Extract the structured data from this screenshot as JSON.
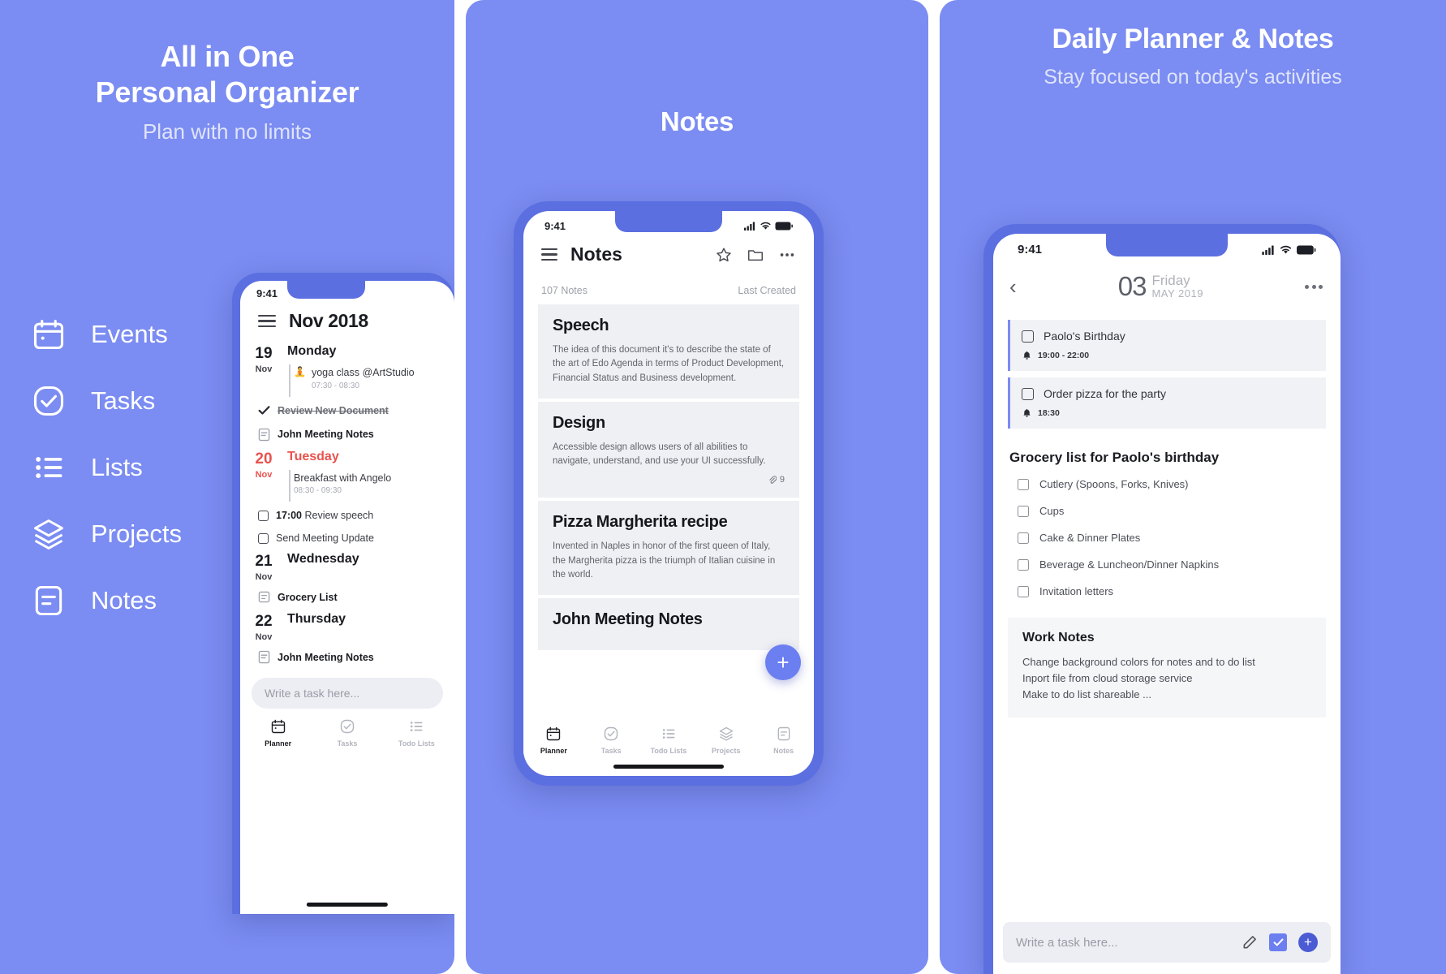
{
  "theme": {
    "brand": "#7b8cf2",
    "phone_frame": "#5b6fe0",
    "accent_red": "#e8534f",
    "fab": "#6c7ff0"
  },
  "panel1": {
    "headline_line1": "All in One",
    "headline_line2": "Personal Organizer",
    "subhead": "Plan with no limits",
    "features": [
      {
        "label": "Events",
        "icon": "calendar-icon"
      },
      {
        "label": "Tasks",
        "icon": "check-circle-icon"
      },
      {
        "label": "Lists",
        "icon": "list-icon"
      },
      {
        "label": "Projects",
        "icon": "layers-icon"
      },
      {
        "label": "Notes",
        "icon": "note-icon"
      }
    ],
    "phone": {
      "status_time": "9:41",
      "month_title": "Nov 2018",
      "days": [
        {
          "num": "19",
          "mon": "Nov",
          "weekday": "Monday",
          "today": false,
          "events": [
            {
              "emoji": "🧘",
              "title": "yoga class @ArtStudio",
              "time": "07:30 - 08:30"
            }
          ],
          "tasks": [
            {
              "type": "done",
              "text": "Review New Document"
            },
            {
              "type": "doc",
              "text": "John Meeting Notes"
            }
          ]
        },
        {
          "num": "20",
          "mon": "Nov",
          "weekday": "Tuesday",
          "today": true,
          "events": [
            {
              "emoji": "",
              "title": "Breakfast with Angelo",
              "time": "08:30 - 09:30"
            }
          ],
          "tasks": [
            {
              "type": "check",
              "bold": "17:00",
              "text": "Review speech"
            },
            {
              "type": "check",
              "bold": "",
              "text": "Send Meeting Update"
            }
          ]
        },
        {
          "num": "21",
          "mon": "Nov",
          "weekday": "Wednesday",
          "today": false,
          "events": [],
          "tasks": [
            {
              "type": "list",
              "text": "Grocery List"
            }
          ]
        },
        {
          "num": "22",
          "mon": "Nov",
          "weekday": "Thursday",
          "today": false,
          "events": [],
          "tasks": [
            {
              "type": "doc",
              "text": "John Meeting Notes"
            }
          ]
        }
      ],
      "input_placeholder": "Write a task here...",
      "tabs": [
        {
          "label": "Planner",
          "icon": "calendar-icon",
          "active": true
        },
        {
          "label": "Tasks",
          "icon": "check-circle-icon",
          "active": false
        },
        {
          "label": "Todo Lists",
          "icon": "list-icon",
          "active": false
        }
      ]
    }
  },
  "panel2": {
    "headline": "Notes",
    "phone": {
      "status_time": "9:41",
      "title": "Notes",
      "header_icons": [
        "menu-icon",
        "star-icon",
        "folder-icon",
        "more-icon"
      ],
      "count_label": "107 Notes",
      "sort_label": "Last Created",
      "notes": [
        {
          "title": "Speech",
          "body": "The idea of this document it's to describe the state of the art of Edo Agenda in terms of Product Development, Financial Status and Business development.",
          "attachments": ""
        },
        {
          "title": "Design",
          "body": "Accessible design allows users of all abilities to navigate, understand, and use your UI successfully.",
          "attachments": "9"
        },
        {
          "title": "Pizza Margherita recipe",
          "body": "Invented in Naples in honor of the first queen of Italy, the Margherita pizza is the triumph of Italian cuisine in the world.",
          "attachments": ""
        },
        {
          "title": "John Meeting Notes",
          "body": "",
          "attachments": ""
        }
      ],
      "fab_label": "+",
      "tabs": [
        {
          "label": "Planner",
          "icon": "calendar-icon",
          "active": true
        },
        {
          "label": "Tasks",
          "icon": "check-circle-icon",
          "active": false
        },
        {
          "label": "Todo Lists",
          "icon": "list-icon",
          "active": false
        },
        {
          "label": "Projects",
          "icon": "layers-icon",
          "active": false
        },
        {
          "label": "Notes",
          "icon": "note-icon",
          "active": false
        }
      ]
    }
  },
  "panel3": {
    "headline": "Daily Planner & Notes",
    "subhead": "Stay focused on today's activities",
    "phone": {
      "status_time": "9:41",
      "date_day": "03",
      "date_weekday": "Friday",
      "date_monthyear": "MAY 2019",
      "tasks": [
        {
          "name": "Paolo's Birthday",
          "time": "19:00 - 22:00"
        },
        {
          "name": "Order pizza for the party",
          "time": "18:30"
        }
      ],
      "list_title": "Grocery list for Paolo's birthday",
      "list_items": [
        "Cutlery (Spoons, Forks, Knives)",
        "Cups",
        "Cake & Dinner Plates",
        "Beverage & Luncheon/Dinner Napkins",
        "Invitation letters"
      ],
      "note_title": "Work Notes",
      "note_lines": [
        "Change background colors for notes and to do list",
        "Inport file from cloud storage service",
        "Make to do list shareable ..."
      ],
      "input_placeholder": "Write a task here...",
      "input_icons": [
        "pencil-icon",
        "checkbox-button",
        "add-button"
      ]
    }
  }
}
